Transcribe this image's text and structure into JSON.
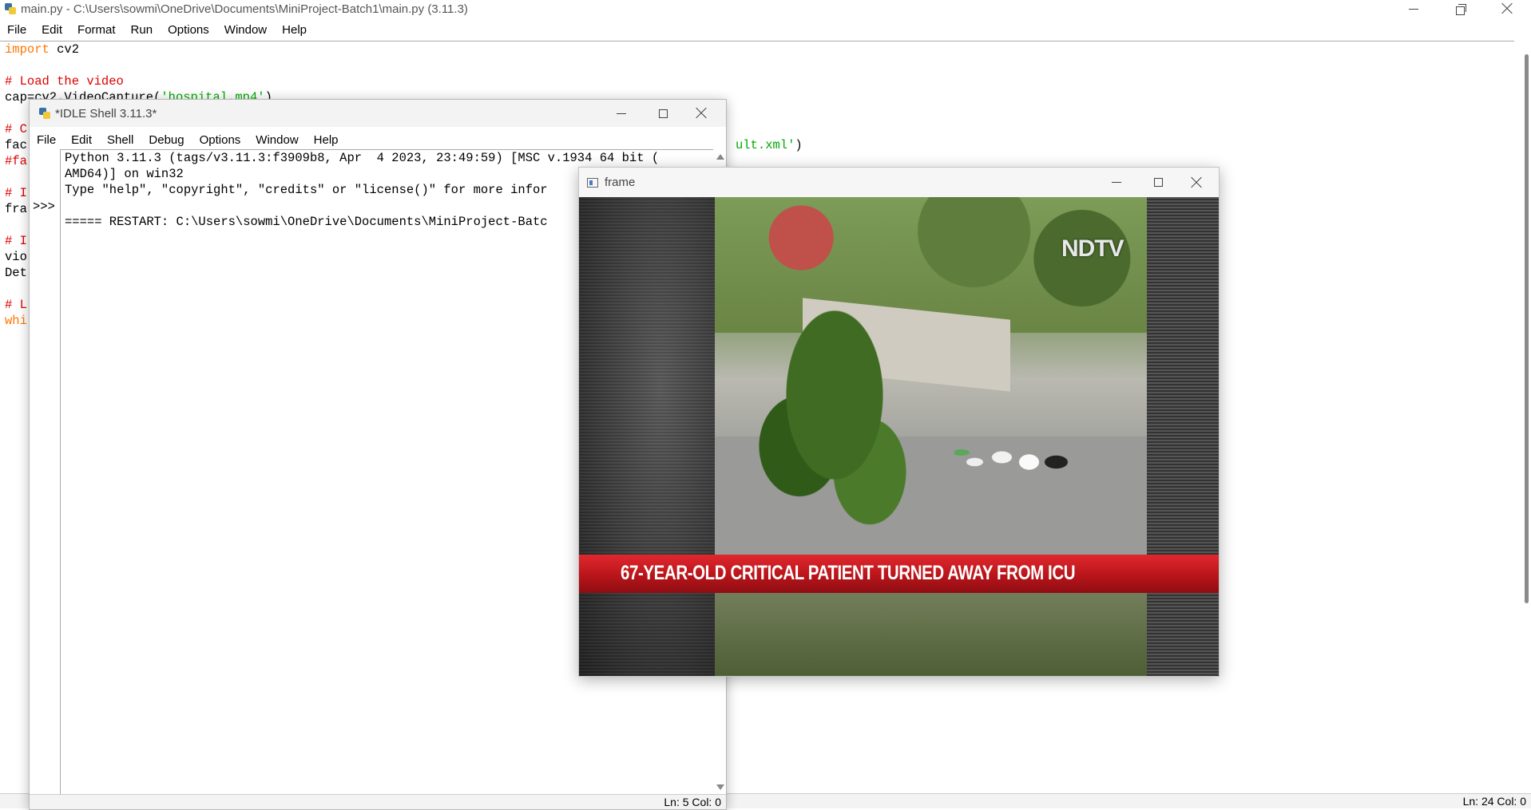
{
  "editor": {
    "title": "main.py - C:\\Users\\sowmi\\OneDrive\\Documents\\MiniProject-Batch1\\main.py (3.11.3)",
    "menu": [
      "File",
      "Edit",
      "Format",
      "Run",
      "Options",
      "Window",
      "Help"
    ],
    "code": {
      "l1_kw": "import",
      "l1_rest": " cv2",
      "l3": "# Load the video",
      "l4_a": "cap=cv2.VideoCapture(",
      "l4_str": "'hospital.mp4'",
      "l4_b": ")",
      "l6": "# C",
      "l7_a": "fac",
      "l7_str": "ult.xml'",
      "l7_b": ")",
      "l8": "#fa",
      "l10": "# I",
      "l11": "fra",
      "l13": "# I",
      "l14": "vio",
      "l15": "Det",
      "l17": "# L",
      "l18_kw": "whi"
    },
    "status": "Ln: 24   Col: 0"
  },
  "shell": {
    "title": "*IDLE Shell 3.11.3*",
    "menu": [
      "File",
      "Edit",
      "Shell",
      "Debug",
      "Options",
      "Window",
      "Help"
    ],
    "prompt": ">>>",
    "lines": [
      "Python 3.11.3 (tags/v3.11.3:f3909b8, Apr  4 2023, 23:49:59) [MSC v.1934 64 bit (",
      "AMD64)] on win32",
      "Type \"help\", \"copyright\", \"credits\" or \"license()\" for more infor",
      "===== RESTART: C:\\Users\\sowmi\\OneDrive\\Documents\\MiniProject-Batc"
    ],
    "status": "Ln: 5   Col: 0"
  },
  "frame": {
    "title": "frame",
    "ticker": "67-YEAR-OLD CRITICAL PATIENT TURNED AWAY FROM ICU",
    "logo": "NDTV"
  },
  "icons": {
    "python": "python-icon",
    "minimize": "minimize-icon",
    "maximize": "maximize-icon",
    "restore": "restore-icon",
    "close": "close-icon"
  }
}
